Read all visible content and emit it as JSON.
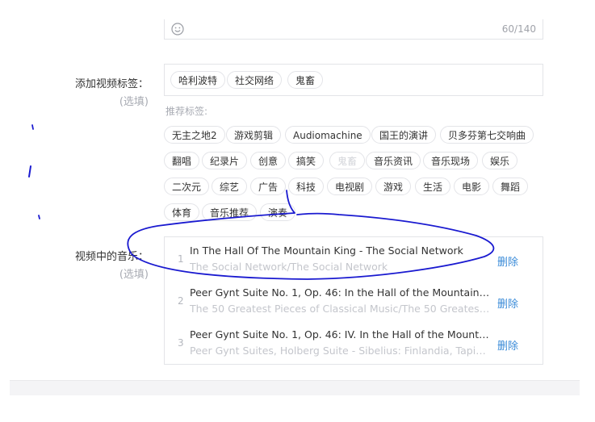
{
  "description": {
    "counter": "60/140"
  },
  "tags_section": {
    "label": "添加视频标签：",
    "optional": "(选填)",
    "added": [
      "哈利波特",
      "社交网络",
      "鬼畜"
    ],
    "recommend_title": "推荐标签:",
    "recommended": [
      [
        "无主之地2",
        "游戏剪辑",
        "Audiomachine",
        "国王的演讲",
        "贝多芬第七交响曲"
      ],
      [
        "翻唱",
        "纪录片",
        "创意",
        "搞笑",
        "鬼畜",
        "音乐资讯",
        "音乐现场",
        "娱乐"
      ],
      [
        "二次元",
        "综艺",
        "广告",
        "科技",
        "电视剧",
        "游戏",
        "生活",
        "电影",
        "舞蹈"
      ],
      [
        "体育",
        "音乐推荐",
        "演奏"
      ]
    ]
  },
  "music_section": {
    "label": "视频中的音乐：",
    "optional": "(选填)",
    "delete_label": "删除",
    "items": [
      {
        "index": "1",
        "title": "In The Hall Of The Mountain King - The Social Network",
        "subtitle": "The Social Network/The Social Network"
      },
      {
        "index": "2",
        "title": "Peer Gynt Suite No. 1, Op. 46: In the Hall of the Mountain King...",
        "subtitle": "The 50 Greatest Pieces of Classical Music/The 50 Greatest Piec..."
      },
      {
        "index": "3",
        "title": "Peer Gynt Suite No. 1, Op. 46: IV. In the Hall of the Mountain Ki...",
        "subtitle": "Peer Gynt Suites, Holberg Suite - Sibelius: Finlandia, Tapiola, V..."
      }
    ]
  },
  "colors": {
    "link": "#3a8bd8",
    "annotation_ink": "#1a1ad0",
    "border": "#e3e4e8"
  },
  "icons": {
    "emoji": "smiley-icon"
  }
}
